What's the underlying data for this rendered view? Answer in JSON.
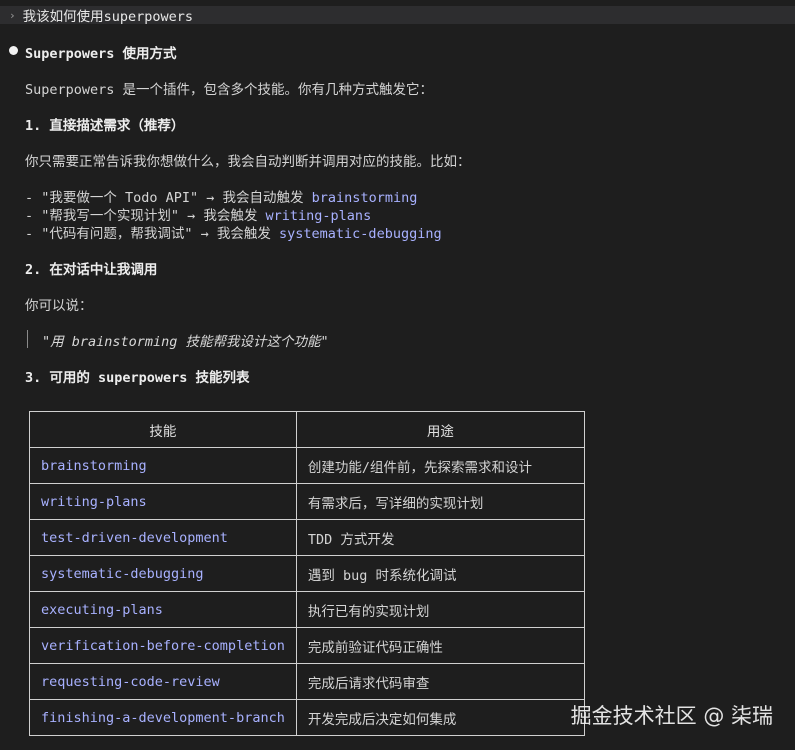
{
  "prompt": {
    "caret": "›",
    "text": "我该如何使用superpowers"
  },
  "response": {
    "title": "Superpowers 使用方式",
    "intro": "Superpowers 是一个插件，包含多个技能。你有几种方式触发它：",
    "section1": {
      "heading": "1. 直接描述需求（推荐）",
      "text": "你只需要正常告诉我你想做什么，我会自动判断并调用对应的技能。比如：",
      "items": [
        {
          "prefix": "- \"我要做一个 Todo API\" → 我会自动触发 ",
          "skill": "brainstorming"
        },
        {
          "prefix": "- \"帮我写一个实现计划\" → 我会触发 ",
          "skill": "writing-plans"
        },
        {
          "prefix": "- \"代码有问题，帮我调试\" → 我会触发 ",
          "skill": "systematic-debugging"
        }
      ]
    },
    "section2": {
      "heading": "2. 在对话中让我调用",
      "text": "你可以说：",
      "quote": "\"用 brainstorming 技能帮我设计这个功能\""
    },
    "section3": {
      "heading_prefix": "3. 可用的 ",
      "heading_code": "superpowers",
      "heading_suffix": " 技能列表",
      "table": {
        "headers": [
          "技能",
          "用途"
        ],
        "rows": [
          [
            "brainstorming",
            "创建功能/组件前，先探索需求和设计"
          ],
          [
            "writing-plans",
            "有需求后，写详细的实现计划"
          ],
          [
            "test-driven-development",
            "TDD 方式开发"
          ],
          [
            "systematic-debugging",
            "遇到 bug 时系统化调试"
          ],
          [
            "executing-plans",
            "执行已有的实现计划"
          ],
          [
            "verification-before-completion",
            "完成前验证代码正确性"
          ],
          [
            "requesting-code-review",
            "完成后请求代码审查"
          ],
          [
            "finishing-a-development-branch",
            "开发完成后决定如何集成"
          ]
        ]
      }
    }
  },
  "watermark": "掘金技术社区 @ 柒瑞",
  "colors": {
    "background": "#1e1e1e",
    "prompt_bar": "#2d2d2f",
    "accent": "#a8b1ff",
    "text": "#d4d4d4",
    "table_border": "#d0d0d0"
  }
}
